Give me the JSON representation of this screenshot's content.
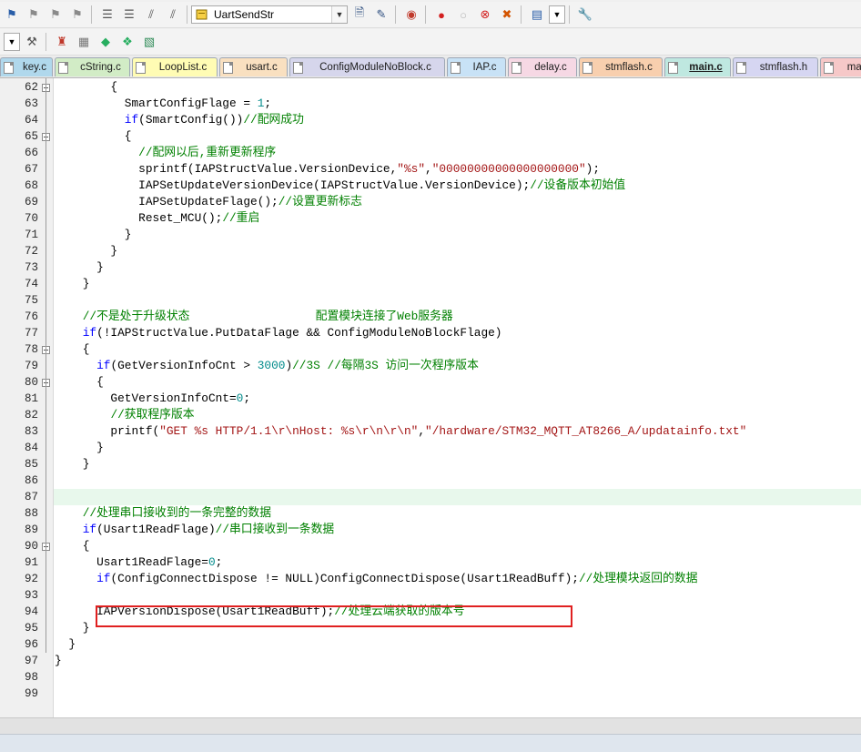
{
  "toolbar": {
    "target_combo_value": "UartSendStr"
  },
  "tabs": [
    {
      "label": "key.c",
      "color": "#b0d8ec"
    },
    {
      "label": "cString.c",
      "color": "#d2ecc6"
    },
    {
      "label": "LoopList.c",
      "color": "#fffcb4"
    },
    {
      "label": "usart.c",
      "color": "#f9e0c0"
    },
    {
      "label": "ConfigModuleNoBlock.c",
      "color": "#d6d6ec"
    },
    {
      "label": "IAP.c",
      "color": "#c8e2f6"
    },
    {
      "label": "delay.c",
      "color": "#f6d8e4"
    },
    {
      "label": "stmflash.c",
      "color": "#f8cfae"
    },
    {
      "label": "main.c",
      "color": "#bfe8e0"
    },
    {
      "label": "stmflash.h",
      "color": "#d6d6f2"
    },
    {
      "label": "mai",
      "color": "#f6c8c8"
    }
  ],
  "editor": {
    "current_line": 87,
    "highlighted_line": 94,
    "lines": [
      {
        "n": 62,
        "t": "        {"
      },
      {
        "n": 63,
        "t": "          SmartConfigFlage = 1;"
      },
      {
        "n": 64,
        "t": "          if(SmartConfig())//配网成功"
      },
      {
        "n": 65,
        "t": "          {"
      },
      {
        "n": 66,
        "t": "            //配网以后,重新更新程序"
      },
      {
        "n": 67,
        "t": "            sprintf(IAPStructValue.VersionDevice,\"%s\",\"00000000000000000000\");"
      },
      {
        "n": 68,
        "t": "            IAPSetUpdateVersionDevice(IAPStructValue.VersionDevice);//设备版本初始值"
      },
      {
        "n": 69,
        "t": "            IAPSetUpdateFlage();//设置更新标志"
      },
      {
        "n": 70,
        "t": "            Reset_MCU();//重启"
      },
      {
        "n": 71,
        "t": "          }"
      },
      {
        "n": 72,
        "t": "        }"
      },
      {
        "n": 73,
        "t": "      }"
      },
      {
        "n": 74,
        "t": "    }"
      },
      {
        "n": 75,
        "t": ""
      },
      {
        "n": 76,
        "t": "    //不是处于升级状态                  配置模块连接了Web服务器"
      },
      {
        "n": 77,
        "t": "    if(!IAPStructValue.PutDataFlage && ConfigModuleNoBlockFlage)"
      },
      {
        "n": 78,
        "t": "    {"
      },
      {
        "n": 79,
        "t": "      if(GetVersionInfoCnt > 3000)//3S //每隔3S 访问一次程序版本"
      },
      {
        "n": 80,
        "t": "      {"
      },
      {
        "n": 81,
        "t": "        GetVersionInfoCnt=0;"
      },
      {
        "n": 82,
        "t": "        //获取程序版本"
      },
      {
        "n": 83,
        "t": "        printf(\"GET %s HTTP/1.1\\r\\nHost: %s\\r\\n\\r\\n\",\"/hardware/STM32_MQTT_AT8266_A/updatainfo.txt\""
      },
      {
        "n": 84,
        "t": "      }"
      },
      {
        "n": 85,
        "t": "    }"
      },
      {
        "n": 86,
        "t": ""
      },
      {
        "n": 87,
        "t": ""
      },
      {
        "n": 88,
        "t": "    //处理串口接收到的一条完整的数据"
      },
      {
        "n": 89,
        "t": "    if(Usart1ReadFlage)//串口接收到一条数据"
      },
      {
        "n": 90,
        "t": "    {"
      },
      {
        "n": 91,
        "t": "      Usart1ReadFlage=0;"
      },
      {
        "n": 92,
        "t": "      if(ConfigConnectDispose != NULL)ConfigConnectDispose(Usart1ReadBuff);//处理模块返回的数据"
      },
      {
        "n": 93,
        "t": ""
      },
      {
        "n": 94,
        "t": "      IAPVersionDispose(Usart1ReadBuff);//处理云端获取的版本号"
      },
      {
        "n": 95,
        "t": "    }"
      },
      {
        "n": 96,
        "t": "  }"
      },
      {
        "n": 97,
        "t": "}"
      },
      {
        "n": 98,
        "t": ""
      },
      {
        "n": 99,
        "t": ""
      }
    ],
    "fold_lines": [
      62,
      65,
      78,
      80,
      90
    ]
  },
  "colors": {
    "keyword": "#0000ff",
    "comment": "#008000",
    "string": "#a31515",
    "number": "#008b8b",
    "highlight_box": "#e02020",
    "current_line_bg": "#e8f8ec"
  }
}
